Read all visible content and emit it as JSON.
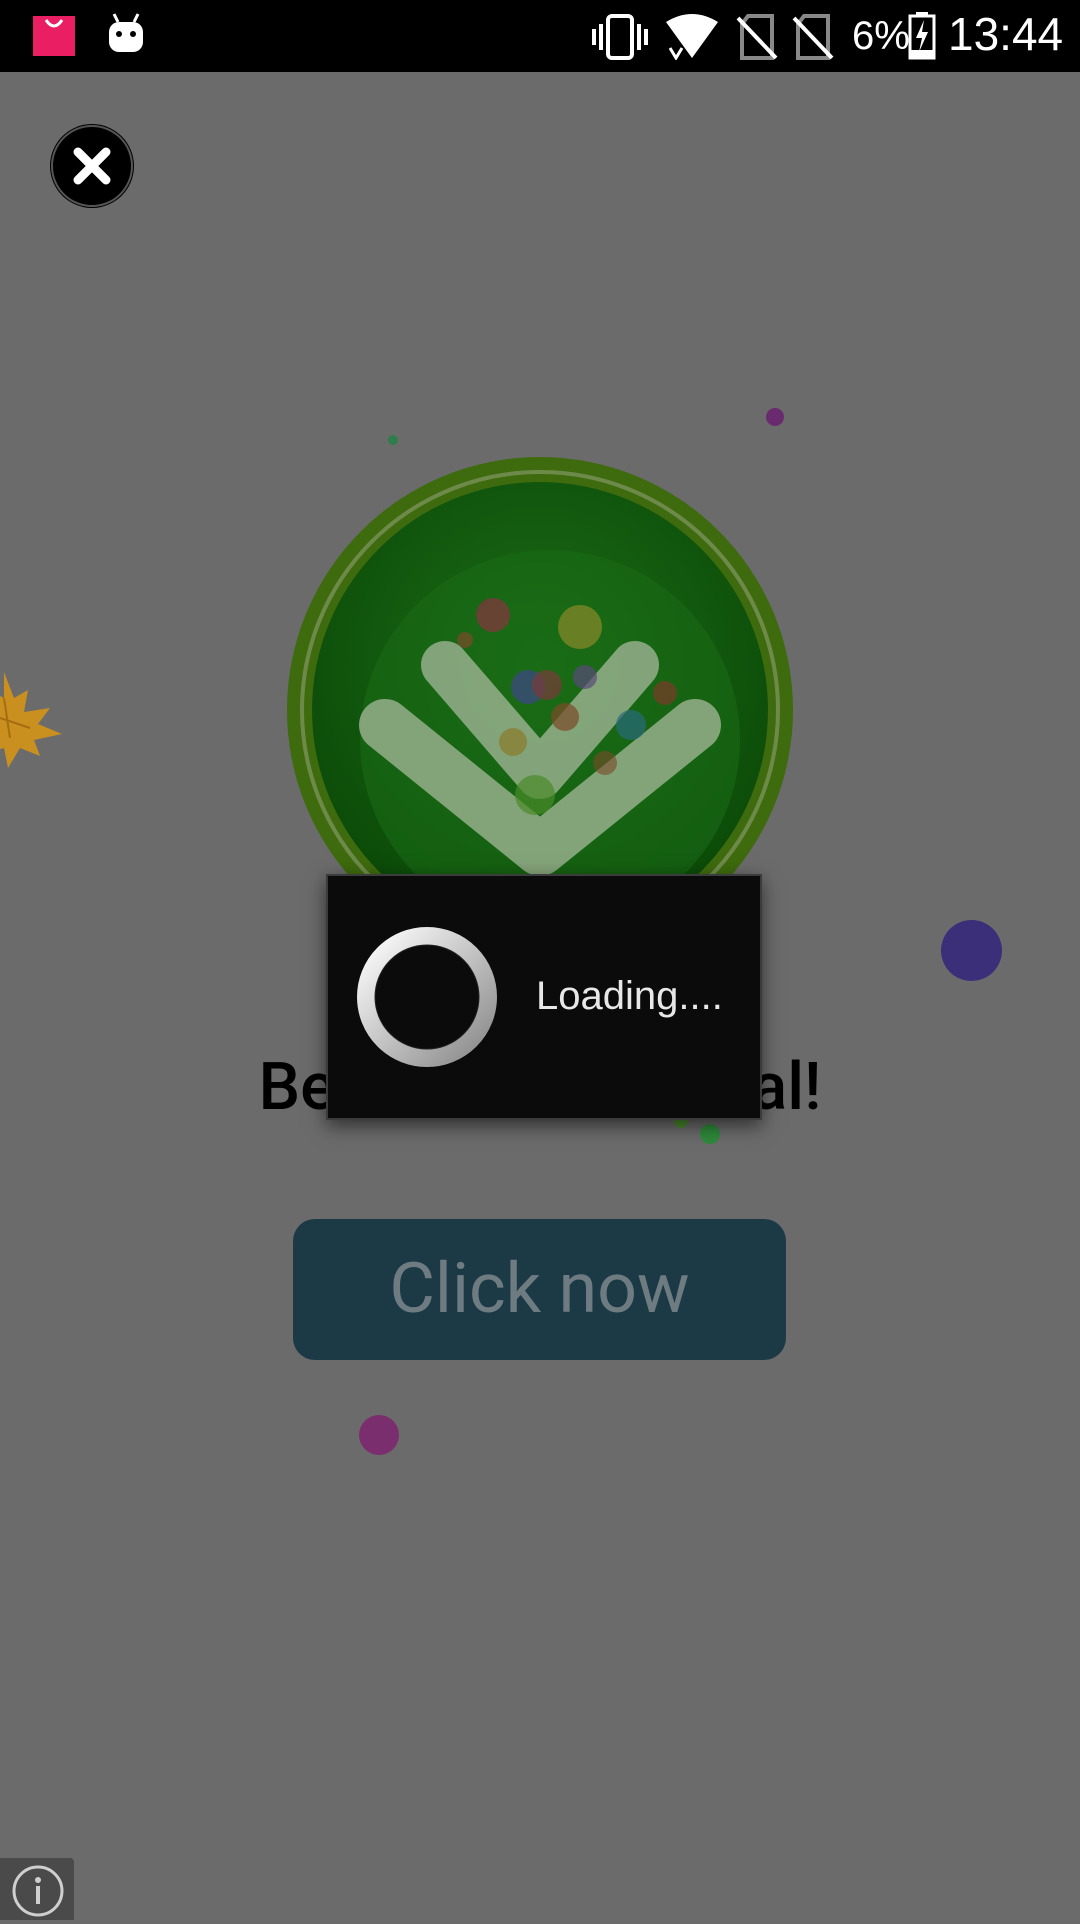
{
  "status_bar": {
    "battery_percent": "6%",
    "time": "13:44",
    "icons": [
      "shopping-bag-icon",
      "android-icon",
      "vibrate-icon",
      "wifi-icon",
      "no-sim-icon",
      "no-sim-icon",
      "battery-charging-icon"
    ],
    "colors": {
      "shopping_bag": "#e91e63",
      "background": "#000000"
    }
  },
  "ad": {
    "close_icon": "close-icon",
    "headline": "Best Mobile Portal!",
    "cta_label": "Click now",
    "info_icon": "info-icon",
    "colors": {
      "overlay_background": "#6b6b6b",
      "logo_green": "#1f6f1a",
      "cta_background": "#1c3a46",
      "cta_text": "#6e7c82"
    }
  },
  "loading_dialog": {
    "message": "Loading....",
    "spinner_icon": "spinner-icon"
  }
}
